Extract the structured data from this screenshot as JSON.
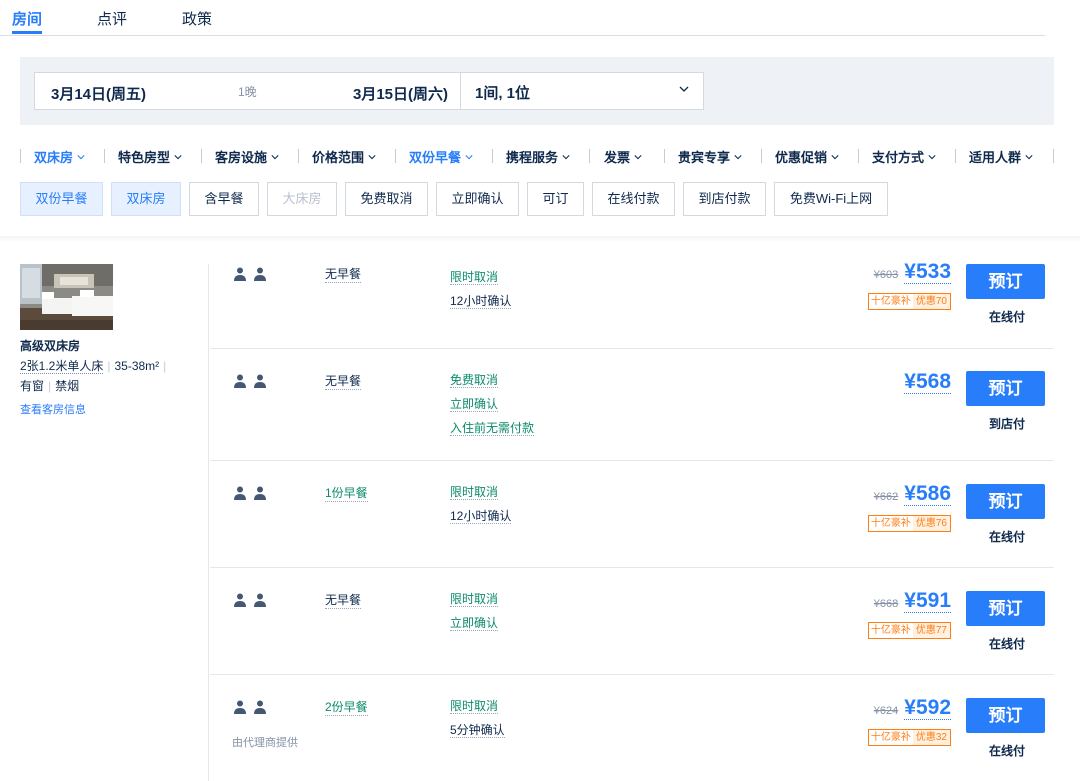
{
  "tabs": [
    {
      "label": "房间",
      "active": true
    },
    {
      "label": "点评",
      "active": false
    },
    {
      "label": "政策",
      "active": false
    }
  ],
  "search": {
    "checkin": "3月14日(周五)",
    "nights": "1晚",
    "checkout": "3月15日(周六)",
    "guests": "1间, 1位"
  },
  "filters": [
    {
      "label": "双床房",
      "active": true
    },
    {
      "label": "特色房型",
      "active": false
    },
    {
      "label": "客房设施",
      "active": false
    },
    {
      "label": "价格范围",
      "active": false
    },
    {
      "label": "双份早餐",
      "active": true
    },
    {
      "label": "携程服务",
      "active": false
    },
    {
      "label": "发票",
      "active": false
    },
    {
      "label": "贵宾专享",
      "active": false
    },
    {
      "label": "优惠促销",
      "active": false
    },
    {
      "label": "支付方式",
      "active": false
    },
    {
      "label": "适用人群",
      "active": false
    }
  ],
  "chips": [
    {
      "label": "双份早餐",
      "state": "selected"
    },
    {
      "label": "双床房",
      "state": "selected"
    },
    {
      "label": "含早餐",
      "state": "normal"
    },
    {
      "label": "大床房",
      "state": "disabled"
    },
    {
      "label": "免费取消",
      "state": "normal"
    },
    {
      "label": "立即确认",
      "state": "normal"
    },
    {
      "label": "可订",
      "state": "normal"
    },
    {
      "label": "在线付款",
      "state": "normal"
    },
    {
      "label": "到店付款",
      "state": "normal"
    },
    {
      "label": "免费Wi-Fi上网",
      "state": "normal"
    }
  ],
  "room": {
    "name": "高级双床房",
    "beds": "2张1.2米单人床",
    "area": "35-38m²",
    "window": "有窗",
    "smoking": "禁烟",
    "info_link": "查看客房信息"
  },
  "rates": [
    {
      "meal": "无早餐",
      "meal_included": false,
      "policies": [
        {
          "text": "限时取消",
          "green": true
        },
        {
          "text": "12小时确认",
          "green": false
        }
      ],
      "old_price": "¥603",
      "price": "¥533",
      "promo_a": "十亿豪补",
      "promo_b": "优惠70",
      "book": "预订",
      "pay": "在线付",
      "agent": ""
    },
    {
      "meal": "无早餐",
      "meal_included": false,
      "policies": [
        {
          "text": "免费取消",
          "green": true
        },
        {
          "text": "立即确认",
          "green": true
        },
        {
          "text": "入住前无需付款",
          "green": true
        }
      ],
      "old_price": "",
      "price": "¥568",
      "promo_a": "",
      "promo_b": "",
      "book": "预订",
      "pay": "到店付",
      "agent": ""
    },
    {
      "meal": "1份早餐",
      "meal_included": true,
      "policies": [
        {
          "text": "限时取消",
          "green": true
        },
        {
          "text": "12小时确认",
          "green": false
        }
      ],
      "old_price": "¥662",
      "price": "¥586",
      "promo_a": "十亿豪补",
      "promo_b": "优惠76",
      "book": "预订",
      "pay": "在线付",
      "agent": ""
    },
    {
      "meal": "无早餐",
      "meal_included": false,
      "policies": [
        {
          "text": "限时取消",
          "green": true
        },
        {
          "text": "立即确认",
          "green": true
        }
      ],
      "old_price": "¥668",
      "price": "¥591",
      "promo_a": "十亿豪补",
      "promo_b": "优惠77",
      "book": "预订",
      "pay": "在线付",
      "agent": ""
    },
    {
      "meal": "2份早餐",
      "meal_included": true,
      "policies": [
        {
          "text": "限时取消",
          "green": true
        },
        {
          "text": "5分钟确认",
          "green": false
        }
      ],
      "old_price": "¥624",
      "price": "¥592",
      "promo_a": "十亿豪补",
      "promo_b": "优惠32",
      "book": "预订",
      "pay": "在线付",
      "agent": "由代理商提供"
    }
  ],
  "colors": {
    "accent": "#287dfa",
    "green": "#0b8a6b",
    "promo": "#ff7d13",
    "text": "#0f294d"
  },
  "icons": {
    "chevron": "chevron-down-icon",
    "person": "person-icon",
    "room_photo": "room-photo"
  }
}
